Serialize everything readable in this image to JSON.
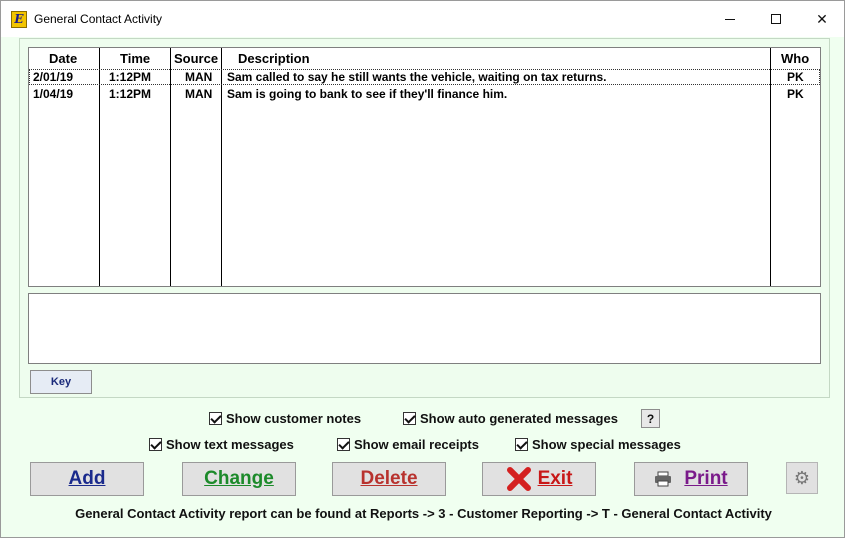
{
  "window": {
    "title": "General Contact Activity",
    "app_icon_glyph": "E",
    "minimize_icon": "minimize-icon",
    "maximize_icon": "maximize-icon",
    "close_symbol": "✕"
  },
  "grid": {
    "columns": [
      "Date",
      "Time",
      "Source",
      "Description",
      "Who"
    ],
    "rows": [
      {
        "date": "2/01/19",
        "time": "1:12PM",
        "source": "MAN",
        "description": "Sam called to say he still wants the vehicle, waiting on tax returns.",
        "who": "PK"
      },
      {
        "date": "1/04/19",
        "time": "1:12PM",
        "source": "MAN",
        "description": "Sam is going to bank to see if they'll finance him.",
        "who": "PK"
      }
    ]
  },
  "notes": {
    "value": ""
  },
  "key_label": "Key",
  "options": {
    "customer_notes": "Show customer notes",
    "auto_generated": "Show auto generated messages",
    "help_label": "?",
    "text_messages": "Show text messages",
    "email_receipts": "Show email receipts",
    "special_messages": "Show special messages"
  },
  "actions": {
    "add": "Add",
    "change": "Change",
    "delete": "Delete",
    "exit": "Exit",
    "print": "Print",
    "settings_symbol": "⚙"
  },
  "footer": "General Contact Activity report can be found at Reports -> 3 - Customer Reporting -> T - General Contact Activity",
  "colors": {
    "background": "#f0fff0",
    "add": "#1a2a8c",
    "change": "#1c8a2a",
    "delete": "#b8322e",
    "exit": "#c81818",
    "print": "#7a1a8a"
  }
}
